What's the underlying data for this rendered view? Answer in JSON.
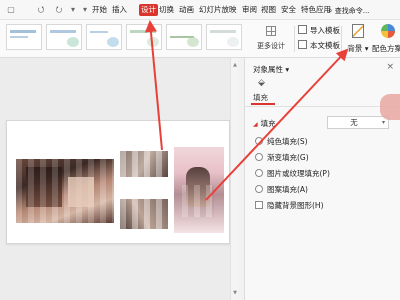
{
  "menubar": {
    "tabs": [
      {
        "label": "开始",
        "active": false
      },
      {
        "label": "插入",
        "active": false
      },
      {
        "label": "设计",
        "active": true
      },
      {
        "label": "切换",
        "active": false
      },
      {
        "label": "动画",
        "active": false
      },
      {
        "label": "幻灯片放映",
        "active": false
      },
      {
        "label": "审阅",
        "active": false
      },
      {
        "label": "视图",
        "active": false
      },
      {
        "label": "安全",
        "active": false
      },
      {
        "label": "特色应用",
        "active": false
      }
    ],
    "search_label": "查找命令..."
  },
  "ribbon": {
    "more_design": "更多设计",
    "import_template": "导入模板",
    "text_template": "本文模板",
    "background": "背景",
    "color_scheme": "配色方案"
  },
  "panel": {
    "title": "对象属性",
    "fill_tab": "填充",
    "section_label": "填充",
    "none_value": "无",
    "options": [
      {
        "label": "纯色填充(S)",
        "type": "radio"
      },
      {
        "label": "渐变填充(G)",
        "type": "radio"
      },
      {
        "label": "图片或纹理填充(P)",
        "type": "radio"
      },
      {
        "label": "图案填充(A)",
        "type": "radio"
      },
      {
        "label": "隐藏背景图形(H)",
        "type": "checkbox"
      }
    ]
  },
  "colors": {
    "accent": "#d9352c",
    "arrow": "#e8413a"
  },
  "icons": [
    "undo-icon",
    "redo-icon",
    "fill-bucket-icon",
    "close-icon",
    "search-icon"
  ]
}
